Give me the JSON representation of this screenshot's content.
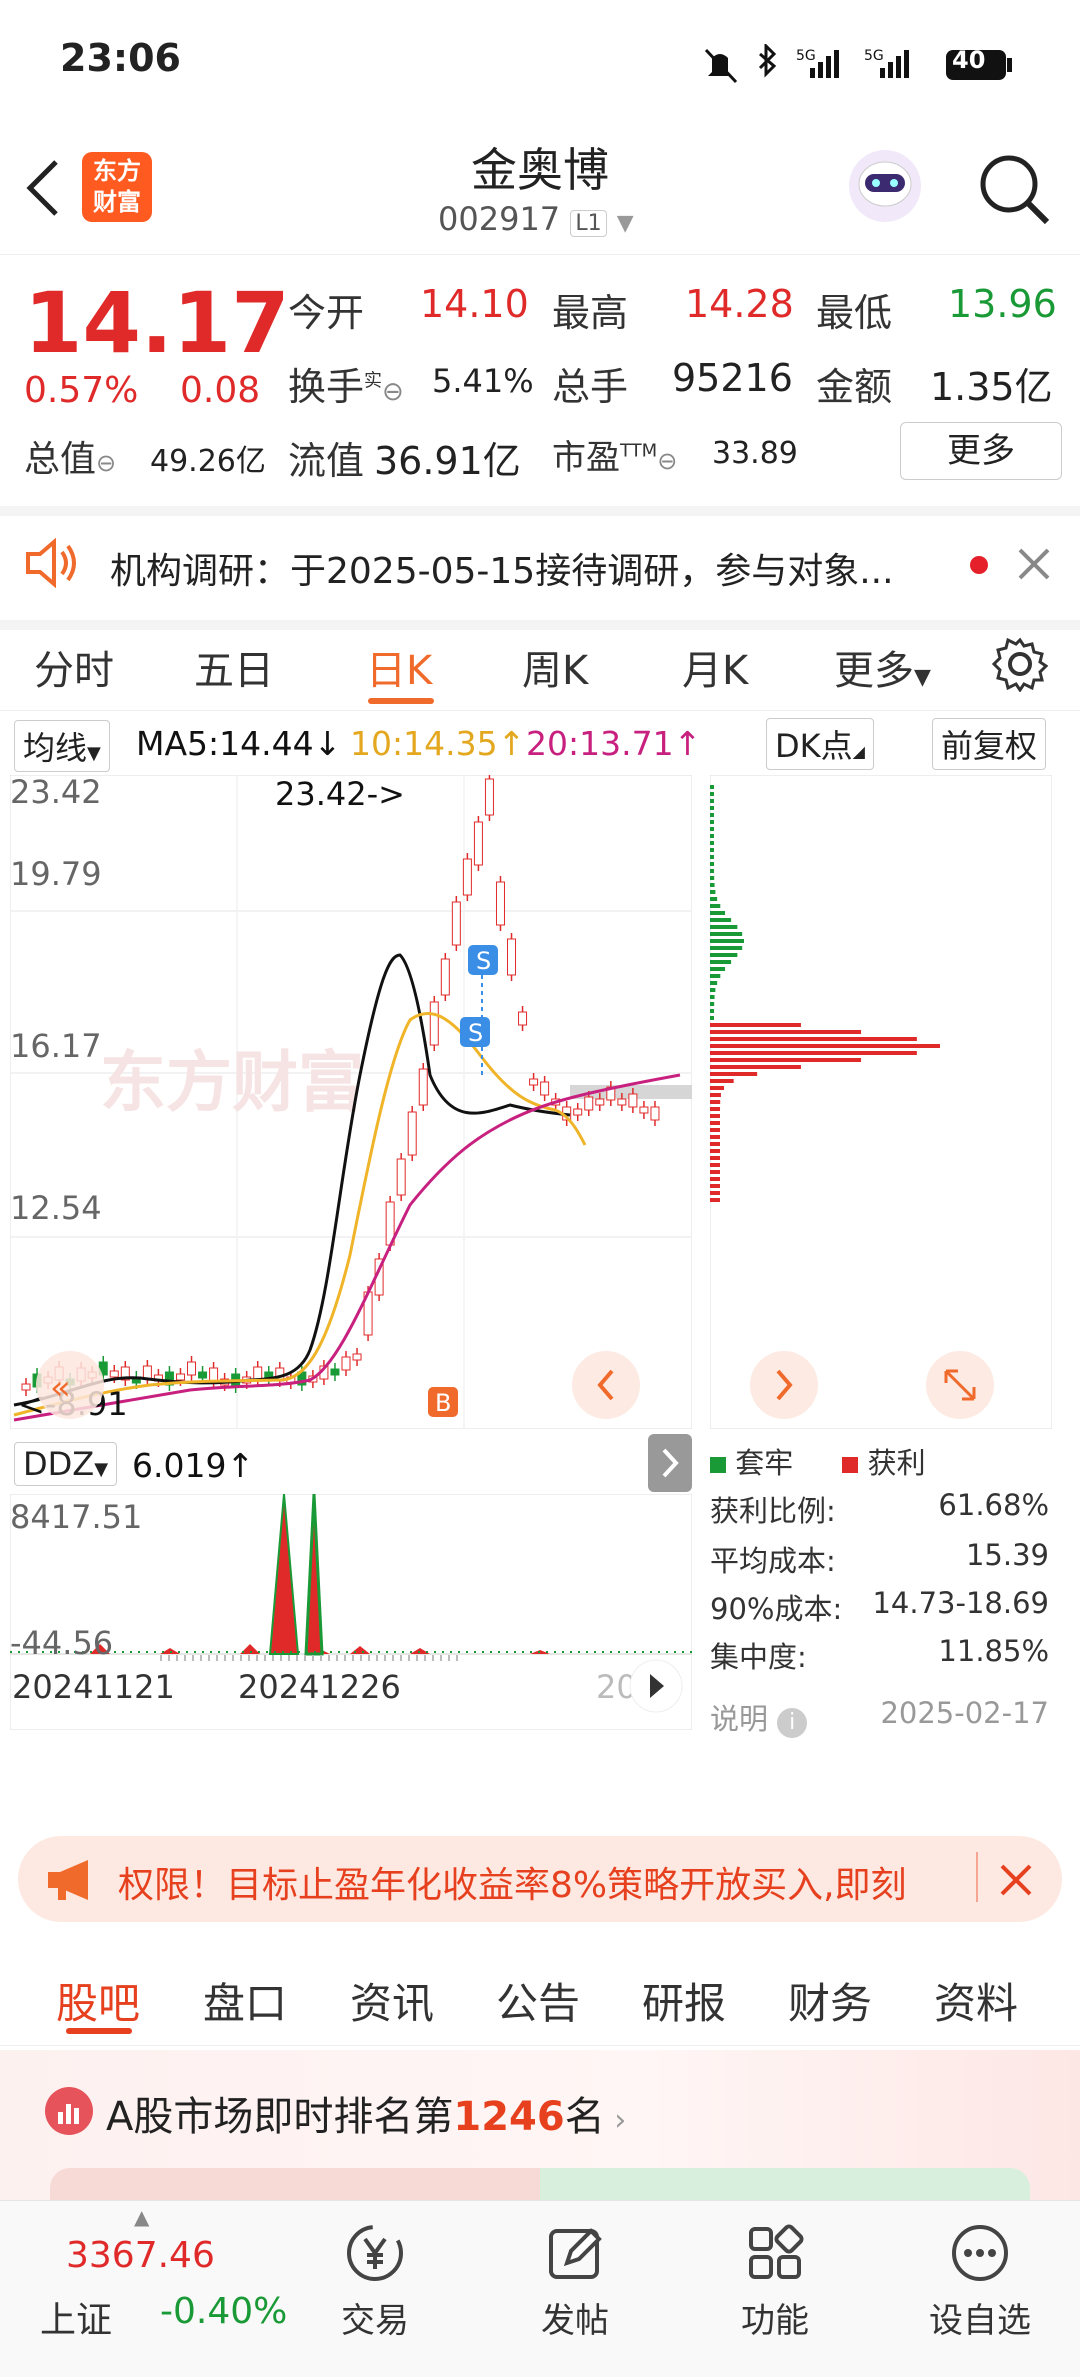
{
  "status": {
    "time": "23:06",
    "battery": "40"
  },
  "header": {
    "title": "金奥博",
    "code": "002917",
    "market_badge": "L1",
    "logo_text_1": "东方",
    "logo_text_2": "财富"
  },
  "quote": {
    "price": "14.17",
    "change_pct": "0.57%",
    "change": "0.08",
    "open_label": "今开",
    "open": "14.10",
    "high_label": "最高",
    "high": "14.28",
    "low_label": "最低",
    "low": "13.96",
    "turnover_label": "换手",
    "turnover_sup": "实",
    "turnover": "5.41%",
    "volume_label": "总手",
    "volume": "95216",
    "amount_label": "金额",
    "amount": "1.35亿",
    "mcap_label": "总值",
    "mcap": "49.26亿",
    "float_label": "流值",
    "float_cap": "36.91亿",
    "pe_label": "市盈",
    "pe_sup": "TTM",
    "pe": "33.89",
    "more_button": "更多"
  },
  "notice": {
    "text": "机构调研：于2025-05-15接待调研，参与对象..."
  },
  "tabs": [
    {
      "label": "分时"
    },
    {
      "label": "五日"
    },
    {
      "label": "日K"
    },
    {
      "label": "周K"
    },
    {
      "label": "月K"
    },
    {
      "label": "更多"
    }
  ],
  "ma": {
    "selector": "均线",
    "ma5": "MA5:14.44↓",
    "ma10": "10:14.35↑",
    "ma20": "20:13.71↑",
    "dk": "DK点",
    "adjust": "前复权"
  },
  "chart_labels": {
    "y_top": "23.42",
    "y2": "19.79",
    "y3": "16.17",
    "y4": "12.54",
    "high_marker": "23.42->",
    "low_marker": "<-8.91",
    "watermark": "东方财富",
    "s_marker": "S",
    "b_marker": "B"
  },
  "ddz": {
    "selector": "DDZ",
    "value": "6.019↑",
    "y_top": "8417.51",
    "y_bottom": "-44.56",
    "date1": "20241121",
    "date2": "20241226",
    "date3": "20"
  },
  "colors": {
    "red": "#e02a2a",
    "green": "#1a9a36",
    "accent": "#f06a2b",
    "ma5": "#111111",
    "ma10": "#f0b429",
    "ma20": "#c8207f"
  },
  "distribution": {
    "legend_trap": "套牢",
    "legend_profit": "获利",
    "profit_ratio_label": "获利比例:",
    "profit_ratio": "61.68%",
    "avg_cost_label": "平均成本:",
    "avg_cost": "15.39",
    "cost90_label": "90%成本:",
    "cost90": "14.73-18.69",
    "concentration_label": "集中度:",
    "concentration": "11.85%",
    "explain_label": "说明",
    "date": "2025-02-17"
  },
  "banner": {
    "text": "权限！目标止盈年化收益率8%策略开放买入,即刻"
  },
  "subtabs": [
    {
      "label": "股吧"
    },
    {
      "label": "盘口"
    },
    {
      "label": "资讯"
    },
    {
      "label": "公告"
    },
    {
      "label": "研报"
    },
    {
      "label": "财务"
    },
    {
      "label": "资料"
    }
  ],
  "rank": {
    "prefix": "A股市场即时排名第",
    "number": "1246",
    "suffix": "名"
  },
  "index": {
    "value": "3367.46",
    "name": "上证",
    "change": "-0.40%"
  },
  "nav": [
    {
      "label": "交易",
      "icon": "yen-trade-icon"
    },
    {
      "label": "发帖",
      "icon": "edit-post-icon"
    },
    {
      "label": "功能",
      "icon": "grid-function-icon"
    },
    {
      "label": "设自选",
      "icon": "more-dots-icon"
    }
  ],
  "chart_data": {
    "type": "candlestick",
    "x_labels": [
      "20241121",
      "20241226"
    ],
    "y_ticks": [
      23.42,
      19.79,
      16.17,
      12.54
    ],
    "ylim": [
      8.91,
      23.42
    ],
    "high_marker": 23.42,
    "low_marker": 8.91,
    "series": [
      {
        "name": "MA5",
        "last": 14.44
      },
      {
        "name": "10",
        "last": 14.35
      },
      {
        "name": "20",
        "last": 13.71
      }
    ]
  }
}
